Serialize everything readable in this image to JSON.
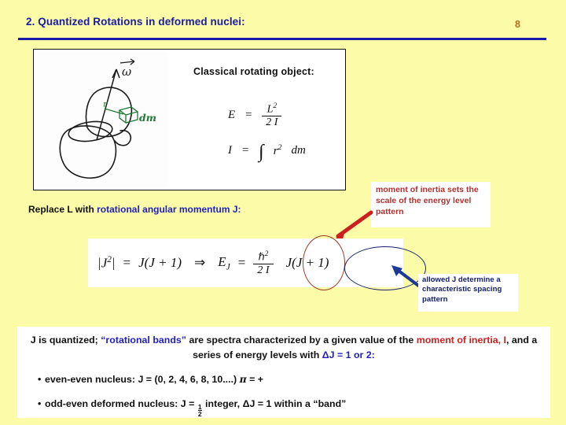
{
  "header": {
    "title": "2.  Quantized Rotations in deformed nuclei:",
    "page_number": "8",
    "title_color": "#1a1aaa",
    "rule_color": "#1a1aaa",
    "page_number_color": "#c06a20"
  },
  "figure": {
    "caption": "Classical rotating object:",
    "sketch_labels": {
      "omega": "ω",
      "radius": "r",
      "mass_element": "dm"
    },
    "equations": {
      "energy_lhs": "E",
      "energy_eq": "=",
      "energy_num": "L",
      "energy_num_pow": "2",
      "energy_den": "2 I",
      "inertia_lhs": "I",
      "inertia_eq": "=",
      "inertia_integral": "∫",
      "inertia_r": "r",
      "inertia_r_pow": "2",
      "inertia_dm": "dm"
    }
  },
  "replace_line": {
    "black_part": "Replace L with ",
    "blue_part": "rotational angular momentum J:"
  },
  "callout_moment_of_inertia": {
    "text": "moment of inertia sets the scale of the energy level pattern",
    "color": "#b03030",
    "arrow_color": "#cc2020"
  },
  "callout_allowed_j": {
    "text": "allowed J determine a characteristic spacing pattern",
    "color": "#15216e",
    "arrow_color": "#1a3a96"
  },
  "main_equation": {
    "lhs_open": "|",
    "lhs_j": "J",
    "lhs_pow": "2",
    "lhs_close": "|",
    "eq1": "=",
    "jj1_a": "J(J + 1)",
    "implies": "⇒",
    "ej": "E",
    "ej_sub": "J",
    "eq2": "=",
    "hbar": "ℏ",
    "hbar_pow": "2",
    "den": "2 I",
    "jj1_b": "J(J + 1)",
    "red_ellipse_color": "#a03a28",
    "navy_ellipse_color": "#15216e"
  },
  "summary": {
    "line1_a": "J is quantized;  ",
    "line1_blue": "“rotational bands”",
    "line1_b": " are spectra characterized by a given value of the",
    "line2_red": "moment of inertia, I",
    "line2_b": ", and a series of energy levels with ",
    "line2_delta": "ΔJ = 1 or 2:",
    "bullets": [
      {
        "marker": "•",
        "text_a": "even-even nucleus:   J = (0, 2, 4, 6, 8, 10....)  ",
        "pi": "π",
        "text_b": " = +"
      },
      {
        "marker": "•",
        "text_a": "odd-even deformed nucleus:   J = ",
        "frac_num": "1",
        "frac_den": "2",
        "text_b": " integer, ΔJ = 1 within a “band”"
      }
    ]
  },
  "colors": {
    "background": "#FCFCA8",
    "panel": "#ffffff",
    "blue_text": "#2222bb",
    "red_text": "#cc2222",
    "navy": "#15216e"
  }
}
